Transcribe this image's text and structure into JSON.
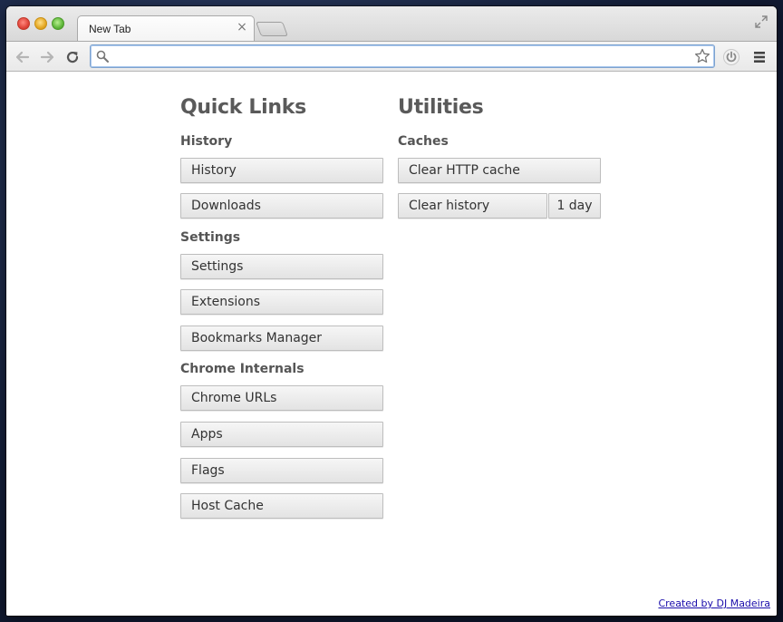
{
  "browser": {
    "tab": {
      "title": "New Tab",
      "close_glyph": "×"
    },
    "omnibox": {
      "value": "",
      "placeholder": ""
    },
    "icons": [
      "close-window",
      "minimize-window",
      "maximize-window",
      "fullscreen-icon",
      "back-arrow-icon",
      "forward-arrow-icon",
      "reload-icon",
      "search-icon",
      "star-icon",
      "power-icon",
      "menu-icon"
    ]
  },
  "quick_links": {
    "title": "Quick Links",
    "groups": [
      {
        "heading": "History",
        "buttons": [
          "History",
          "Downloads"
        ]
      },
      {
        "heading": "Settings",
        "buttons": [
          "Settings",
          "Extensions",
          "Bookmarks Manager"
        ]
      },
      {
        "heading": "Chrome Internals",
        "buttons": [
          "Chrome URLs",
          "Apps",
          "Flags",
          "Host Cache"
        ]
      }
    ]
  },
  "utilities": {
    "title": "Utilities",
    "groups": [
      {
        "heading": "Caches",
        "clear_http_cache": "Clear HTTP cache",
        "clear_history": "Clear history",
        "history_range": "1 day"
      }
    ]
  },
  "footer": {
    "credit": "Created by DJ Madeira"
  }
}
